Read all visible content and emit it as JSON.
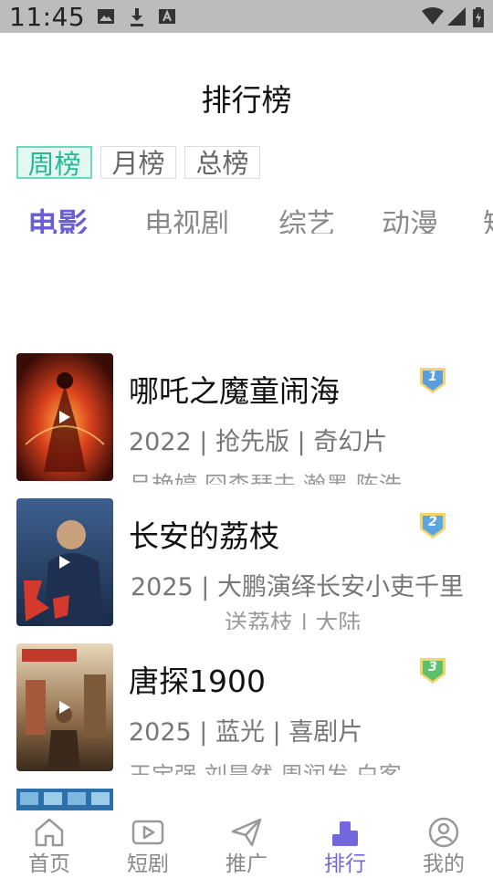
{
  "status_bar": {
    "time": "11:45",
    "left_icons": [
      "image-icon",
      "download-icon",
      "font-icon"
    ],
    "right_icons": [
      "wifi-icon",
      "signal-icon",
      "battery-charging-icon"
    ]
  },
  "page": {
    "title": "排行榜"
  },
  "period_tabs": [
    {
      "label": "周榜",
      "active": true
    },
    {
      "label": "月榜",
      "active": false
    },
    {
      "label": "总榜",
      "active": false
    }
  ],
  "category_tabs": [
    {
      "label": "电影",
      "active": true
    },
    {
      "label": "电视剧",
      "active": false
    },
    {
      "label": "综艺",
      "active": false
    },
    {
      "label": "动漫",
      "active": false
    },
    {
      "label": "短剧",
      "active": false
    }
  ],
  "ranking_list": [
    {
      "rank": "1",
      "title": "哪吒之魔童闹海",
      "meta": "2022 | 抢先版 | 奇幻片",
      "cast": "吕艳婷,囧森瑟夫,瀚墨,陈浩"
    },
    {
      "rank": "2",
      "title": "长安的荔枝",
      "meta": "2025 | 大鹏演绎长安小吏千里",
      "cast": "送荔枝 | 大陆"
    },
    {
      "rank": "3",
      "title": "唐探1900",
      "meta": "2025 | 蓝光 | 喜剧片",
      "cast": "王宝强,刘昊然,周润发,白客"
    }
  ],
  "bottom_nav": [
    {
      "label": "首页",
      "icon": "home-icon",
      "active": false
    },
    {
      "label": "短剧",
      "icon": "play-video-icon",
      "active": false
    },
    {
      "label": "推广",
      "icon": "paper-plane-icon",
      "active": false
    },
    {
      "label": "排行",
      "icon": "ranking-icon",
      "active": true
    },
    {
      "label": "我的",
      "icon": "user-icon",
      "active": false
    }
  ],
  "colors": {
    "accent": "#6a5fd6",
    "period_active_bg": "#e2f8f1",
    "period_active_text": "#2bb595",
    "status_bar": "#bcbcbc"
  }
}
